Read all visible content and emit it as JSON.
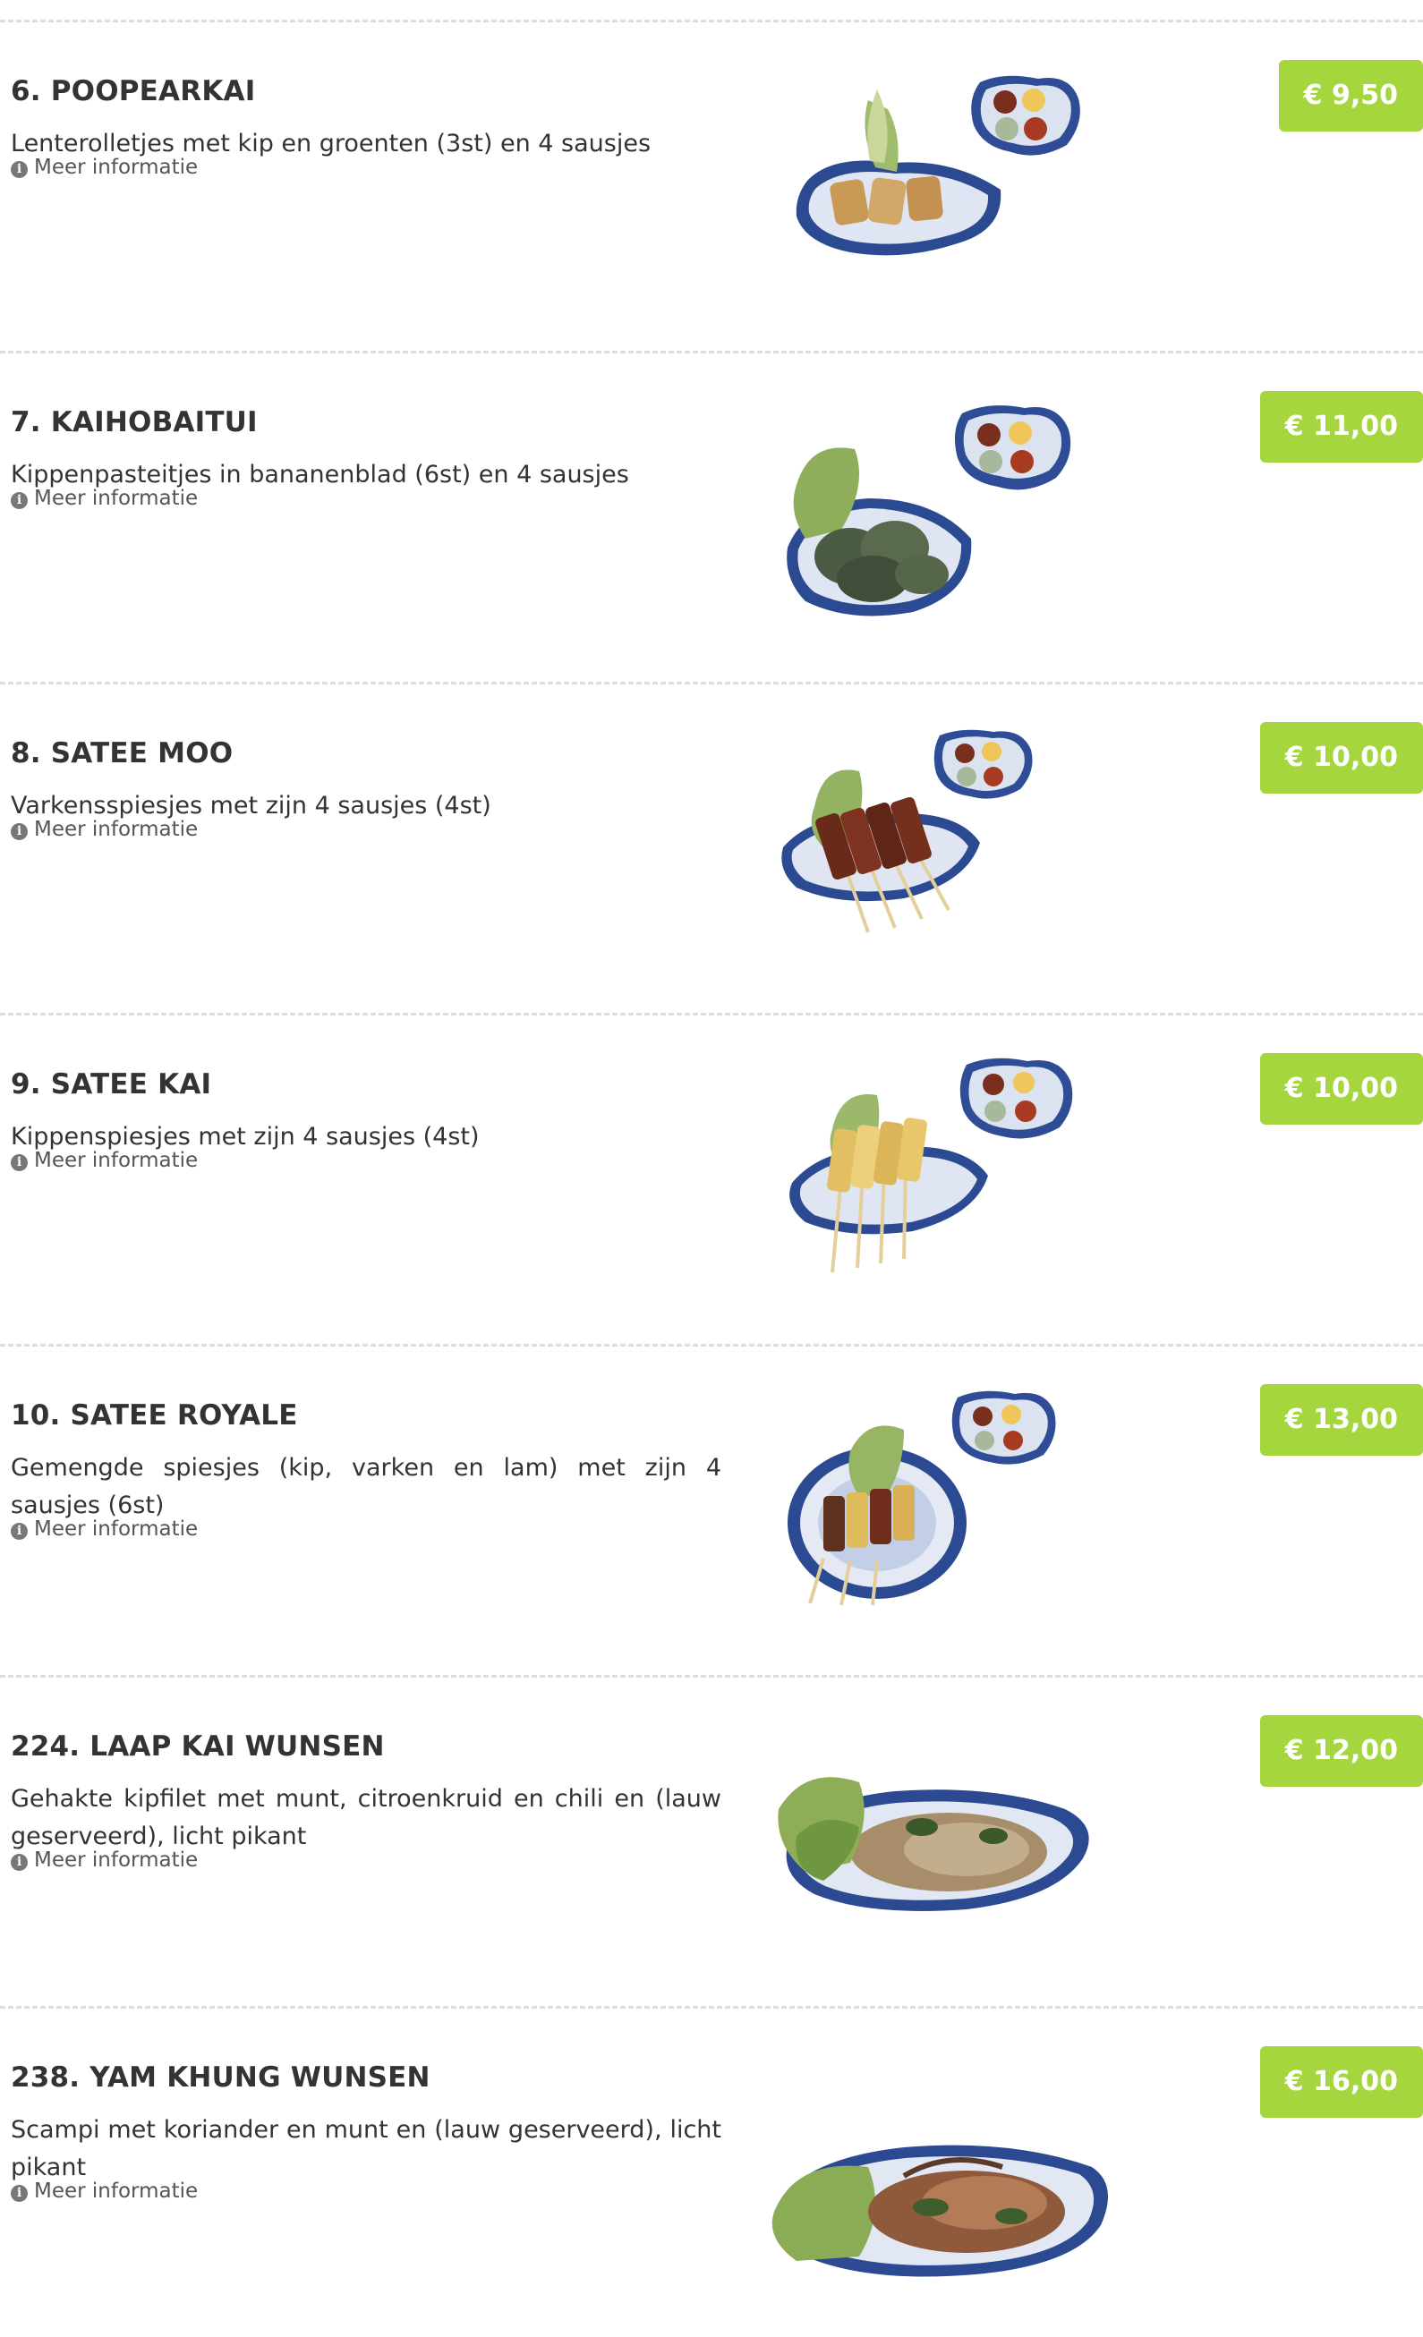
{
  "menu": {
    "more_info_label": "Meer informatie",
    "info_icon": "info-circle-icon",
    "price_color": "#a5d63d",
    "items": [
      {
        "title": "6. POOPEARKAI",
        "description": "Lenterolletjes met kip en groenten (3st) en 4 sausjes",
        "price": "€ 9,50",
        "photo": "spring-rolls-with-dipping-sauces"
      },
      {
        "title": "7. KAIHOBAITUI",
        "description": "Kippenpasteitjes in bananenblad (6st) en 4 sausjes",
        "price": "€ 11,00",
        "photo": "chicken-in-banana-leaf-with-dipping-sauces"
      },
      {
        "title": "8. SATEE MOO",
        "description": "Varkensspiesjes met zijn 4 sausjes (4st)",
        "price": "€ 10,00",
        "photo": "pork-skewers-with-dipping-sauces"
      },
      {
        "title": "9. SATEE KAI",
        "description": "Kippenspiesjes met zijn 4 sausjes (4st)",
        "price": "€ 10,00",
        "photo": "chicken-skewers-with-dipping-sauces"
      },
      {
        "title": "10. SATEE ROYALE",
        "description": "Gemengde spiesjes (kip, varken en lam) met zijn 4 sausjes (6st)",
        "price": "€ 13,00",
        "photo": "mixed-skewers-with-dipping-sauces"
      },
      {
        "title": "224. LAAP KAI WUNSEN",
        "description": "Gehakte kipfilet met munt, citroenkruid en chili en (lauw geserveerd), licht pikant",
        "price": "€ 12,00",
        "photo": "minced-chicken-salad"
      },
      {
        "title": "238. YAM KHUNG WUNSEN",
        "description": "Scampi met koriander en munt en (lauw geserveerd), licht pikant",
        "price": "€ 16,00",
        "photo": "scampi-salad"
      }
    ]
  }
}
